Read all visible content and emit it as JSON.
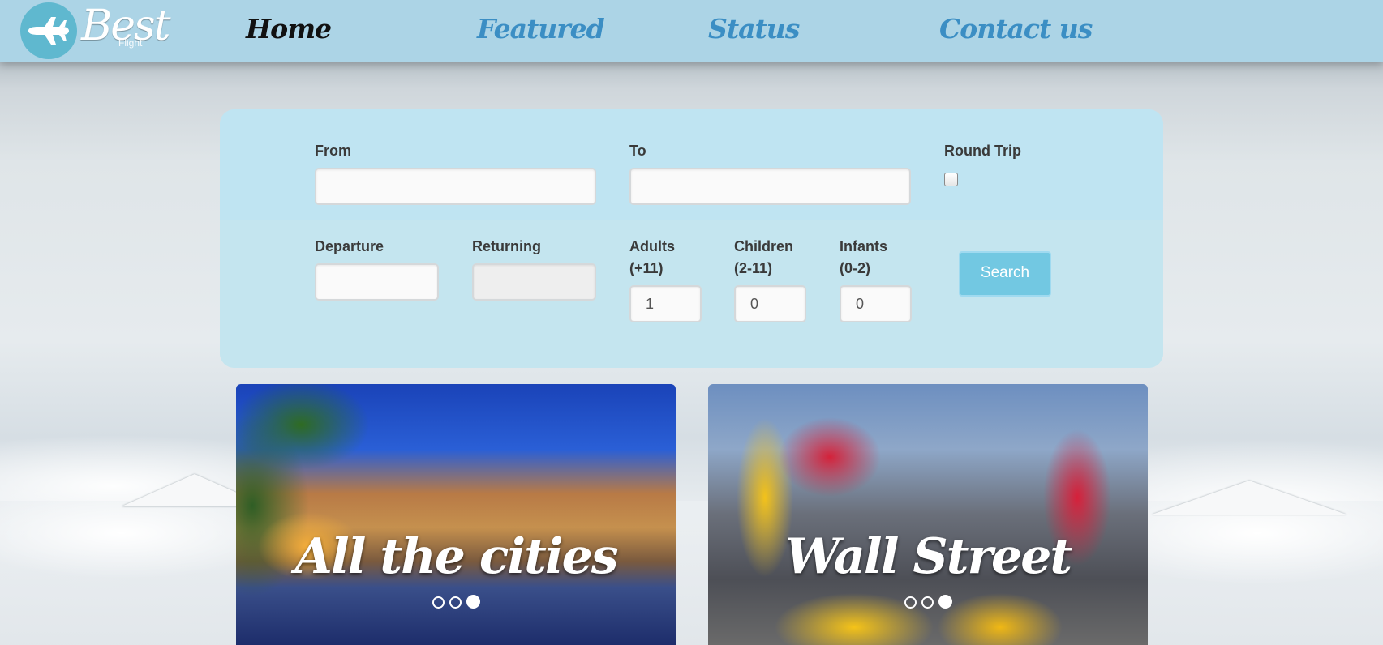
{
  "brand": {
    "logo_text": "Best",
    "logo_subtext": "Flight"
  },
  "nav": {
    "items": [
      {
        "label": "Home"
      },
      {
        "label": "Featured"
      },
      {
        "label": "Status"
      },
      {
        "label": "Contact us"
      }
    ]
  },
  "search_form": {
    "from_label": "From",
    "from_value": "",
    "to_label": "To",
    "to_value": "",
    "round_trip_label": "Round Trip",
    "round_trip_checked": false,
    "departure_label": "Departure",
    "departure_value": "",
    "returning_label": "Returning",
    "returning_value": "",
    "adults_label_line1": "Adults",
    "adults_label_line2": "(+11)",
    "adults_value": "1",
    "children_label_line1": "Children",
    "children_label_line2": "(2-11)",
    "children_value": "0",
    "infants_label_line1": "Infants",
    "infants_label_line2": "(0-2)",
    "infants_value": "0",
    "search_button_label": "Search"
  },
  "carousels": [
    {
      "caption": "All the cities",
      "slide_count": 3,
      "active_slide": 3
    },
    {
      "caption": "Wall Street",
      "slide_count": 3,
      "active_slide": 3
    }
  ],
  "colors": {
    "header_bg": "#acd4e6",
    "nav_link": "#3b8ec4",
    "nav_active": "#111111",
    "panel_bg": "#c3e5f0",
    "search_button": "#72c8e2"
  }
}
